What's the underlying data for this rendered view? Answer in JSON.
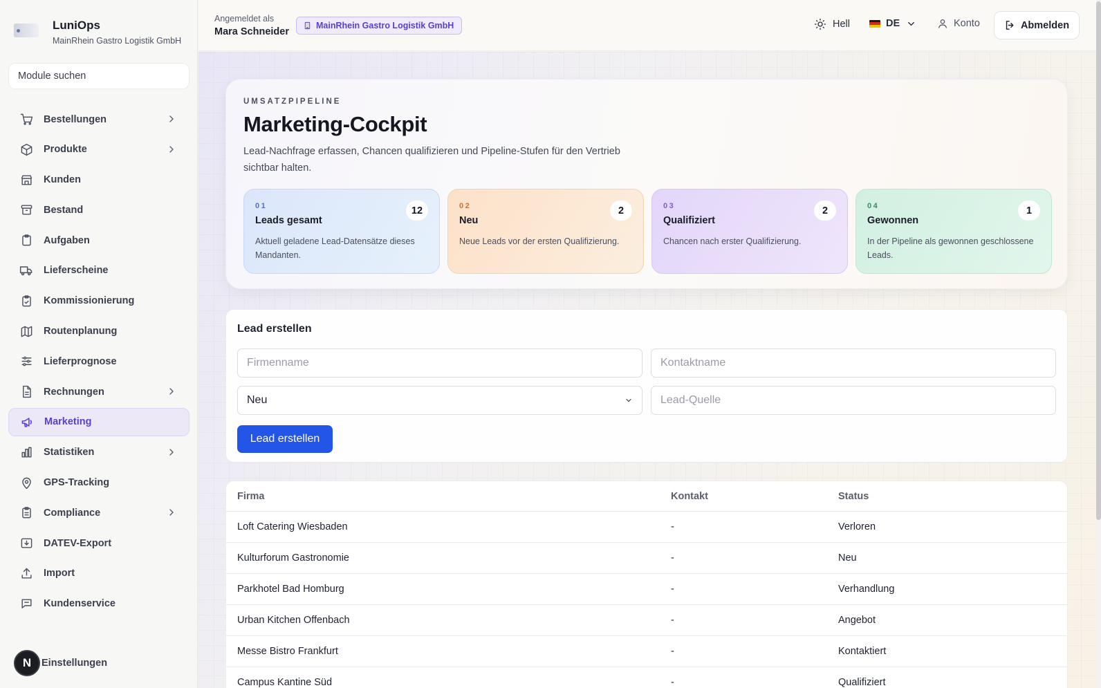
{
  "brand": {
    "name": "LuniOps",
    "subtitle": "MainRhein Gastro Logistik GmbH"
  },
  "search": {
    "placeholder": "Module suchen"
  },
  "nav": [
    {
      "label": "Bestellungen",
      "icon": "cart-icon",
      "chevron": true
    },
    {
      "label": "Produkte",
      "icon": "box-icon",
      "chevron": true
    },
    {
      "label": "Kunden",
      "icon": "store-icon",
      "chevron": false
    },
    {
      "label": "Bestand",
      "icon": "archive-icon",
      "chevron": false
    },
    {
      "label": "Aufgaben",
      "icon": "clipboard-icon",
      "chevron": false
    },
    {
      "label": "Lieferscheine",
      "icon": "truck-icon",
      "chevron": false
    },
    {
      "label": "Kommissionierung",
      "icon": "clipboard-check-icon",
      "chevron": false
    },
    {
      "label": "Routenplanung",
      "icon": "map-icon",
      "chevron": false
    },
    {
      "label": "Lieferprognose",
      "icon": "sliders-icon",
      "chevron": false
    },
    {
      "label": "Rechnungen",
      "icon": "file-icon",
      "chevron": true
    },
    {
      "label": "Marketing",
      "icon": "megaphone-icon",
      "chevron": false,
      "active": true
    },
    {
      "label": "Statistiken",
      "icon": "bar-chart-icon",
      "chevron": true
    },
    {
      "label": "GPS-Tracking",
      "icon": "map-pin-icon",
      "chevron": false
    },
    {
      "label": "Compliance",
      "icon": "clipboard-list-icon",
      "chevron": true
    },
    {
      "label": "DATEV-Export",
      "icon": "download-icon",
      "chevron": false
    },
    {
      "label": "Import",
      "icon": "upload-icon",
      "chevron": false
    },
    {
      "label": "Kundenservice",
      "icon": "chat-icon",
      "chevron": false
    }
  ],
  "settings": {
    "badge": "N",
    "label": "Einstellungen"
  },
  "header": {
    "signed_in_label": "Angemeldet als",
    "user_name": "Mara Schneider",
    "tenant": "MainRhein Gastro Logistik GmbH",
    "theme_label": "Hell",
    "language": "DE",
    "account_label": "Konto",
    "logout_label": "Abmelden"
  },
  "hero": {
    "eyebrow": "UMSATZPIPELINE",
    "title": "Marketing-Cockpit",
    "description": "Lead-Nachfrage erfassen, Chancen qualifizieren und Pipeline-Stufen für den Vertrieb sichtbar halten.",
    "cards": [
      {
        "num": "01",
        "title": "Leads gesamt",
        "count": "12",
        "desc": "Aktuell geladene Lead-Datensätze dieses Mandanten."
      },
      {
        "num": "02",
        "title": "Neu",
        "count": "2",
        "desc": "Neue Leads vor der ersten Qualifizierung."
      },
      {
        "num": "03",
        "title": "Qualifiziert",
        "count": "2",
        "desc": "Chancen nach erster Qualifizierung."
      },
      {
        "num": "04",
        "title": "Gewonnen",
        "count": "1",
        "desc": "In der Pipeline als gewonnen geschlossene Leads."
      }
    ]
  },
  "form": {
    "title": "Lead erstellen",
    "company_placeholder": "Firmenname",
    "contact_placeholder": "Kontaktname",
    "status_value": "Neu",
    "source_placeholder": "Lead-Quelle",
    "submit_label": "Lead erstellen"
  },
  "table": {
    "headers": [
      "Firma",
      "Kontakt",
      "Status"
    ],
    "rows": [
      [
        "Loft Catering Wiesbaden",
        "-",
        "Verloren"
      ],
      [
        "Kulturforum Gastronomie",
        "-",
        "Neu"
      ],
      [
        "Parkhotel Bad Homburg",
        "-",
        "Verhandlung"
      ],
      [
        "Urban Kitchen Offenbach",
        "-",
        "Angebot"
      ],
      [
        "Messe Bistro Frankfurt",
        "-",
        "Kontaktiert"
      ],
      [
        "Campus Kantine Süd",
        "-",
        "Qualifiziert"
      ]
    ]
  },
  "colors": {
    "accent": "#5a3fcf",
    "primary_button": "#2356e8"
  }
}
